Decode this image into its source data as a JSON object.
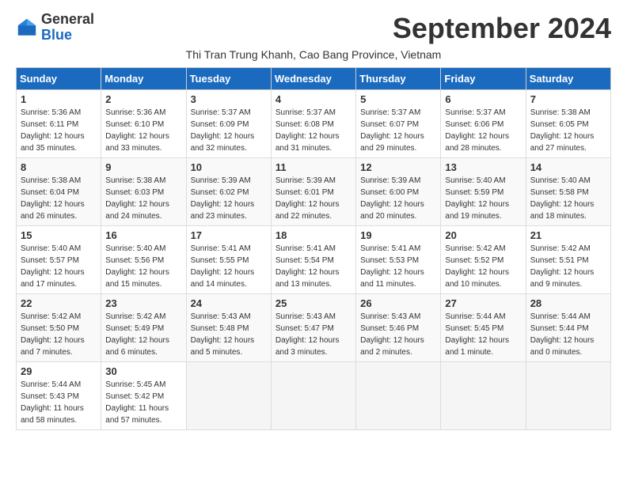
{
  "header": {
    "logo_general": "General",
    "logo_blue": "Blue",
    "month_title": "September 2024",
    "subtitle": "Thi Tran Trung Khanh, Cao Bang Province, Vietnam"
  },
  "weekdays": [
    "Sunday",
    "Monday",
    "Tuesday",
    "Wednesday",
    "Thursday",
    "Friday",
    "Saturday"
  ],
  "weeks": [
    [
      {
        "day": "1",
        "detail": "Sunrise: 5:36 AM\nSunset: 6:11 PM\nDaylight: 12 hours\nand 35 minutes."
      },
      {
        "day": "2",
        "detail": "Sunrise: 5:36 AM\nSunset: 6:10 PM\nDaylight: 12 hours\nand 33 minutes."
      },
      {
        "day": "3",
        "detail": "Sunrise: 5:37 AM\nSunset: 6:09 PM\nDaylight: 12 hours\nand 32 minutes."
      },
      {
        "day": "4",
        "detail": "Sunrise: 5:37 AM\nSunset: 6:08 PM\nDaylight: 12 hours\nand 31 minutes."
      },
      {
        "day": "5",
        "detail": "Sunrise: 5:37 AM\nSunset: 6:07 PM\nDaylight: 12 hours\nand 29 minutes."
      },
      {
        "day": "6",
        "detail": "Sunrise: 5:37 AM\nSunset: 6:06 PM\nDaylight: 12 hours\nand 28 minutes."
      },
      {
        "day": "7",
        "detail": "Sunrise: 5:38 AM\nSunset: 6:05 PM\nDaylight: 12 hours\nand 27 minutes."
      }
    ],
    [
      {
        "day": "8",
        "detail": "Sunrise: 5:38 AM\nSunset: 6:04 PM\nDaylight: 12 hours\nand 26 minutes."
      },
      {
        "day": "9",
        "detail": "Sunrise: 5:38 AM\nSunset: 6:03 PM\nDaylight: 12 hours\nand 24 minutes."
      },
      {
        "day": "10",
        "detail": "Sunrise: 5:39 AM\nSunset: 6:02 PM\nDaylight: 12 hours\nand 23 minutes."
      },
      {
        "day": "11",
        "detail": "Sunrise: 5:39 AM\nSunset: 6:01 PM\nDaylight: 12 hours\nand 22 minutes."
      },
      {
        "day": "12",
        "detail": "Sunrise: 5:39 AM\nSunset: 6:00 PM\nDaylight: 12 hours\nand 20 minutes."
      },
      {
        "day": "13",
        "detail": "Sunrise: 5:40 AM\nSunset: 5:59 PM\nDaylight: 12 hours\nand 19 minutes."
      },
      {
        "day": "14",
        "detail": "Sunrise: 5:40 AM\nSunset: 5:58 PM\nDaylight: 12 hours\nand 18 minutes."
      }
    ],
    [
      {
        "day": "15",
        "detail": "Sunrise: 5:40 AM\nSunset: 5:57 PM\nDaylight: 12 hours\nand 17 minutes."
      },
      {
        "day": "16",
        "detail": "Sunrise: 5:40 AM\nSunset: 5:56 PM\nDaylight: 12 hours\nand 15 minutes."
      },
      {
        "day": "17",
        "detail": "Sunrise: 5:41 AM\nSunset: 5:55 PM\nDaylight: 12 hours\nand 14 minutes."
      },
      {
        "day": "18",
        "detail": "Sunrise: 5:41 AM\nSunset: 5:54 PM\nDaylight: 12 hours\nand 13 minutes."
      },
      {
        "day": "19",
        "detail": "Sunrise: 5:41 AM\nSunset: 5:53 PM\nDaylight: 12 hours\nand 11 minutes."
      },
      {
        "day": "20",
        "detail": "Sunrise: 5:42 AM\nSunset: 5:52 PM\nDaylight: 12 hours\nand 10 minutes."
      },
      {
        "day": "21",
        "detail": "Sunrise: 5:42 AM\nSunset: 5:51 PM\nDaylight: 12 hours\nand 9 minutes."
      }
    ],
    [
      {
        "day": "22",
        "detail": "Sunrise: 5:42 AM\nSunset: 5:50 PM\nDaylight: 12 hours\nand 7 minutes."
      },
      {
        "day": "23",
        "detail": "Sunrise: 5:42 AM\nSunset: 5:49 PM\nDaylight: 12 hours\nand 6 minutes."
      },
      {
        "day": "24",
        "detail": "Sunrise: 5:43 AM\nSunset: 5:48 PM\nDaylight: 12 hours\nand 5 minutes."
      },
      {
        "day": "25",
        "detail": "Sunrise: 5:43 AM\nSunset: 5:47 PM\nDaylight: 12 hours\nand 3 minutes."
      },
      {
        "day": "26",
        "detail": "Sunrise: 5:43 AM\nSunset: 5:46 PM\nDaylight: 12 hours\nand 2 minutes."
      },
      {
        "day": "27",
        "detail": "Sunrise: 5:44 AM\nSunset: 5:45 PM\nDaylight: 12 hours\nand 1 minute."
      },
      {
        "day": "28",
        "detail": "Sunrise: 5:44 AM\nSunset: 5:44 PM\nDaylight: 12 hours\nand 0 minutes."
      }
    ],
    [
      {
        "day": "29",
        "detail": "Sunrise: 5:44 AM\nSunset: 5:43 PM\nDaylight: 11 hours\nand 58 minutes."
      },
      {
        "day": "30",
        "detail": "Sunrise: 5:45 AM\nSunset: 5:42 PM\nDaylight: 11 hours\nand 57 minutes."
      },
      {
        "day": "",
        "detail": ""
      },
      {
        "day": "",
        "detail": ""
      },
      {
        "day": "",
        "detail": ""
      },
      {
        "day": "",
        "detail": ""
      },
      {
        "day": "",
        "detail": ""
      }
    ]
  ]
}
